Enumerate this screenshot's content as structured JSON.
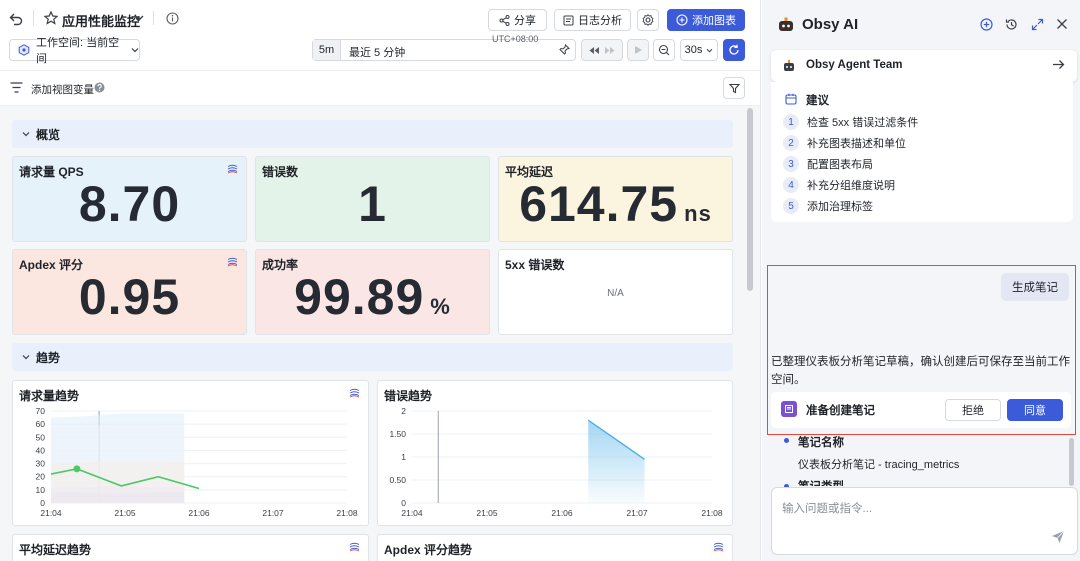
{
  "header": {
    "title": "应用性能监控",
    "share_label": "分享",
    "log_label": "日志分析",
    "add_chart_label": "添加图表",
    "workspace_label": "工作空间: 当前空间",
    "time_quick": "5m",
    "time_range": "最近 5 分钟",
    "timezone": "UTC+08:00",
    "refresh_interval": "30s"
  },
  "varbar": {
    "add_var_label": "添加视图变量"
  },
  "sections": {
    "overview": "概览",
    "trend": "趋势"
  },
  "stats": [
    {
      "title": "请求量 QPS",
      "value": "8.70",
      "unit": "",
      "bg": "#e6f2fa"
    },
    {
      "title": "错误数",
      "value": "1",
      "unit": "",
      "bg": "#e4f3ea"
    },
    {
      "title": "平均延迟",
      "value": "614.75",
      "unit": "ns",
      "bg": "#fbf5e0"
    },
    {
      "title": "Apdex 评分",
      "value": "0.95",
      "unit": "",
      "bg": "#fbe6e0"
    },
    {
      "title": "成功率",
      "value": "99.89",
      "unit": "%",
      "bg": "#fbe6e6"
    },
    {
      "title": "5xx 错误数",
      "value": "N/A",
      "unit": "",
      "bg": "#ffffff"
    }
  ],
  "panels": {
    "req_trend": "请求量趋势",
    "err_trend": "错误趋势",
    "latency_trend": "平均延迟趋势",
    "apdex_trend": "Apdex 评分趋势"
  },
  "chart_data": [
    {
      "type": "line",
      "title": "请求量趋势",
      "x": [
        "21:04",
        "21:05",
        "21:06",
        "21:07",
        "21:08"
      ],
      "ylim": [
        0,
        70
      ],
      "yticks": [
        0,
        10,
        20,
        30,
        40,
        50,
        60,
        70
      ],
      "series": [
        {
          "values_x": [
            0,
            0.35,
            0.95,
            1.45,
            2.0,
            2.65
          ],
          "values": [
            22,
            26,
            13,
            20,
            11,
            null
          ]
        }
      ]
    },
    {
      "type": "area",
      "title": "错误趋势",
      "x": [
        "21:04",
        "21:05",
        "21:06",
        "21:07",
        "21:08"
      ],
      "ylim": [
        0,
        2
      ],
      "yticks": [
        "0",
        "0.50",
        "1",
        "1.50",
        "2"
      ],
      "series": [
        {
          "values_x": [
            2.35,
            3.1
          ],
          "values": [
            1.8,
            0.95
          ]
        }
      ]
    }
  ],
  "ai": {
    "title": "Obsy AI",
    "team": "Obsy Agent Team",
    "suggest_title": "建议",
    "suggestions": [
      {
        "n": "1",
        "text": "检查 5xx 错误过滤条件"
      },
      {
        "n": "2",
        "text": "补充图表描述和单位"
      },
      {
        "n": "3",
        "text": "配置图表布局"
      },
      {
        "n": "4",
        "text": "补充分组维度说明"
      },
      {
        "n": "5",
        "text": "添加治理标签"
      }
    ],
    "user_msg": "生成笔记",
    "reply": "已整理仪表板分析笔记草稿，确认创建后可保存至当前工作空间。",
    "confirm_title": "准备创建笔记",
    "reject_label": "拒绝",
    "agree_label": "同意",
    "note_name_label": "笔记名称",
    "note_name_value": "仪表板分析笔记 - tracing_metrics",
    "note_type_label": "笔记类型",
    "input_placeholder": "输入问题或指令..."
  },
  "colors": {
    "accent": "#3b5bdb",
    "red_highlight": "#e5483b",
    "line_green": "#4cc76a",
    "area_blue": "#7cc4ee"
  }
}
